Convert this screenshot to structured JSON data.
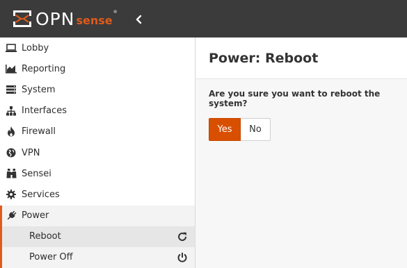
{
  "brand": {
    "name_primary": "OPN",
    "name_secondary": "sense",
    "registered": "®"
  },
  "colors": {
    "accent": "#e05a1a",
    "topbar": "#3b3b3b",
    "yes_button": "#d94f00"
  },
  "sidebar": {
    "items": [
      {
        "label": "Lobby",
        "icon": "laptop-icon"
      },
      {
        "label": "Reporting",
        "icon": "area-chart-icon"
      },
      {
        "label": "System",
        "icon": "server-icon"
      },
      {
        "label": "Interfaces",
        "icon": "sitemap-icon"
      },
      {
        "label": "Firewall",
        "icon": "fire-icon"
      },
      {
        "label": "VPN",
        "icon": "globe-icon"
      },
      {
        "label": "Sensei",
        "icon": "binoculars-icon"
      },
      {
        "label": "Services",
        "icon": "gear-icon"
      },
      {
        "label": "Power",
        "icon": "plug-icon"
      }
    ],
    "sub_items": [
      {
        "label": "Reboot",
        "icon": "refresh-icon"
      },
      {
        "label": "Power Off",
        "icon": "power-icon"
      }
    ]
  },
  "main": {
    "title": "Power: Reboot",
    "question": "Are you sure you want to reboot the system?",
    "yes_label": "Yes",
    "no_label": "No"
  }
}
